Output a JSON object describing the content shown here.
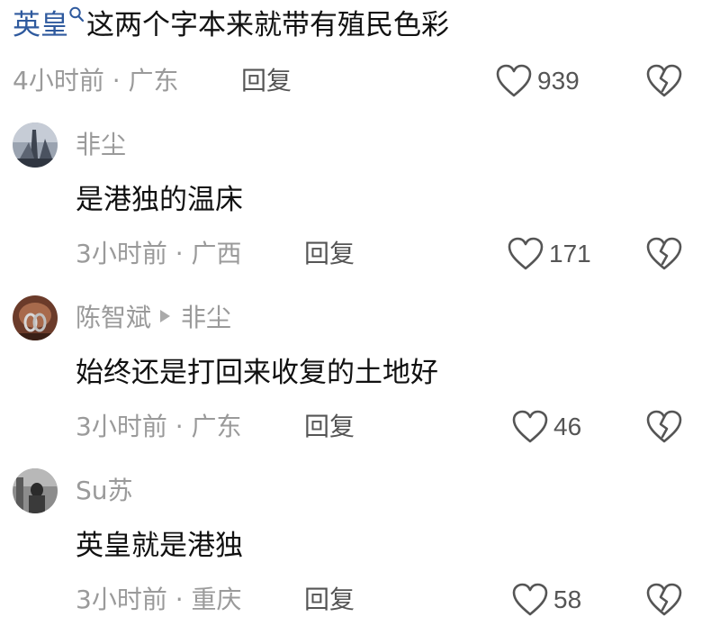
{
  "top_comment": {
    "keyword": "英皇",
    "text": "这两个字本来就带有殖民色彩",
    "meta": "4小时前 · 广东",
    "reply_label": "回复",
    "likes": "939"
  },
  "replies": [
    {
      "username": "非尘",
      "content": "是港独的温床",
      "meta": "3小时前 · 广西",
      "reply_label": "回复",
      "likes": "171"
    },
    {
      "username": "陈智斌",
      "reply_to": "非尘",
      "content": "始终还是打回来收复的土地好",
      "meta": "3小时前 · 广东",
      "reply_label": "回复",
      "likes": "46"
    },
    {
      "username": "Su苏",
      "content": "英皇就是港独",
      "meta": "3小时前 · 重庆",
      "reply_label": "回复",
      "likes": "58"
    }
  ],
  "icons": {
    "like": "heart-outline-icon",
    "dislike": "broken-heart-icon",
    "search": "search-icon",
    "reply_arrow": "triangle-right-icon"
  },
  "colors": {
    "keyword": "#2f5a9e",
    "meta": "#9a9a9a",
    "reply": "#555555",
    "text": "#111111"
  }
}
